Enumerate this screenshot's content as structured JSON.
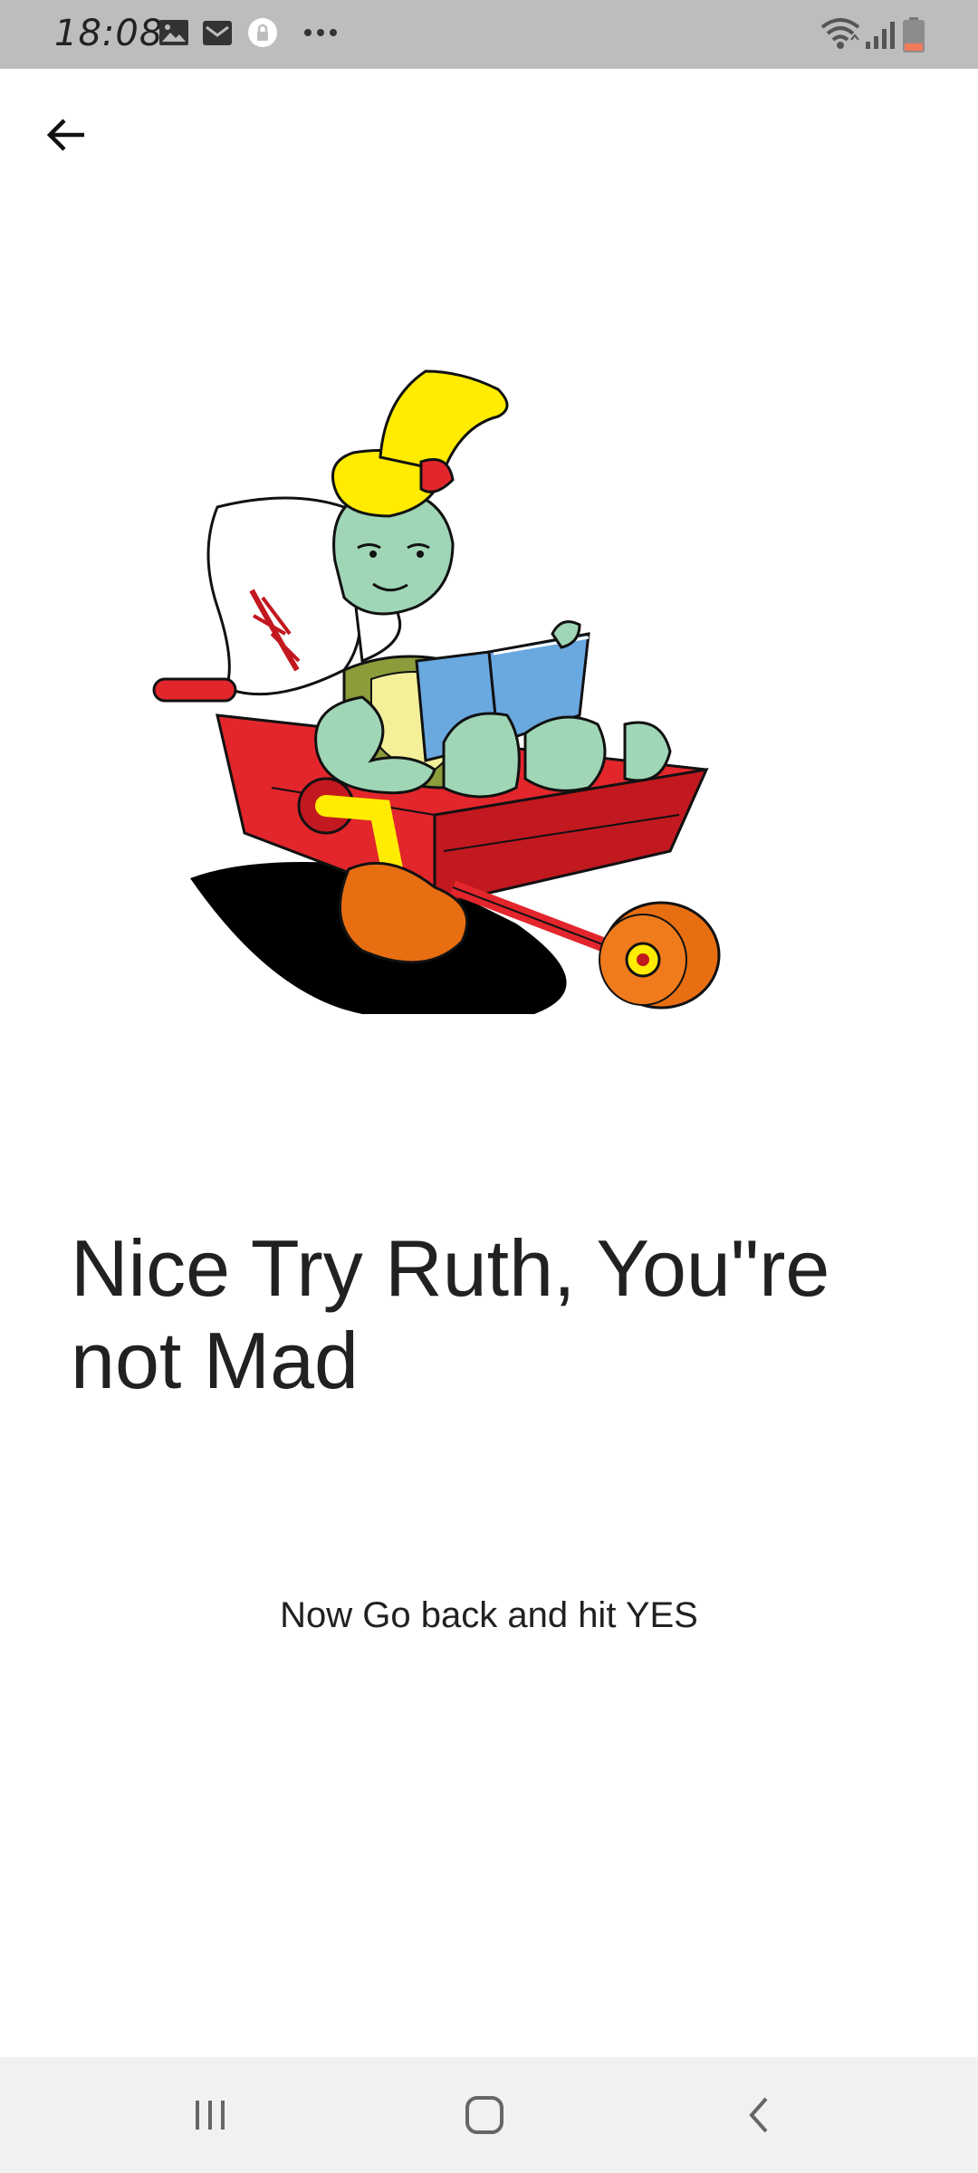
{
  "status_bar": {
    "time": "18:08",
    "left_icons": [
      "gallery-icon",
      "mail-icon",
      "vpn-lock-icon",
      "more-dots-icon"
    ],
    "right_icons": [
      "wifi-icon",
      "signal-icon",
      "battery-icon"
    ],
    "battery_color": "#f07a5a"
  },
  "app_bar": {
    "back_icon": "arrow-left-icon"
  },
  "content": {
    "illustration": "turtle-in-wheelbarrow-illustration",
    "headline": "Nice Try Ruth, You\"re not Mad",
    "subline": "Now Go back and hit YES"
  },
  "nav_bar": {
    "buttons": [
      "recent-apps-icon",
      "home-icon",
      "back-icon"
    ]
  },
  "colors": {
    "status_bar_bg": "#bdbdbd",
    "nav_bar_bg": "#f1f1f1",
    "text": "#212121"
  }
}
